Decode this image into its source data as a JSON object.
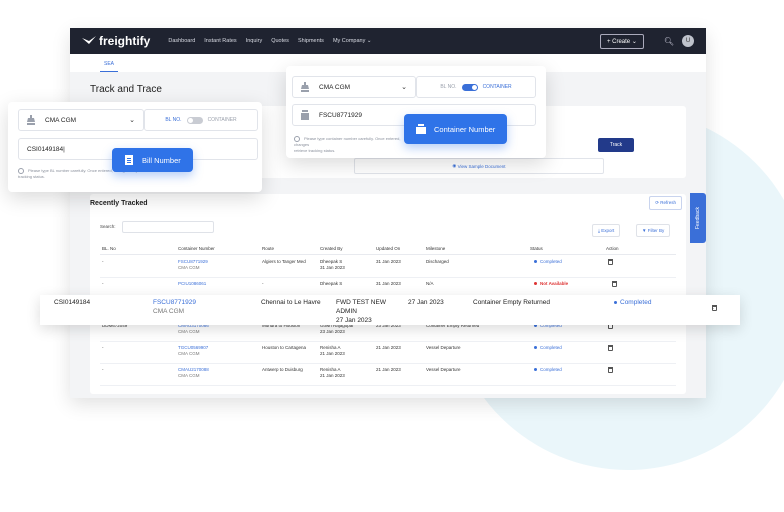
{
  "brand": {
    "name": "freightify"
  },
  "nav": {
    "items": [
      "Dashboard",
      "Instant Rates",
      "Inquiry",
      "Quotes",
      "Shipments",
      "My Company"
    ]
  },
  "header": {
    "create_label": "+ Create",
    "avatar_initial": "U"
  },
  "subtabs": {
    "active": "SEA"
  },
  "page": {
    "title": "Track and Trace"
  },
  "track_form": {
    "carrier": "CMA CGM",
    "bl_label": "BL NO.",
    "container_label": "CONTAINER",
    "container_value": "FSCU8771929",
    "bill_value": "CSI0149184",
    "hint_text": "Please type container number carefully. Once entered, changes",
    "hint_text2": "retrieve tracking status.",
    "hint_bl": "Please type BL number carefully. Once entered, changes may take time to retrieve",
    "hint_bl2": "tracking status.",
    "track_label": "Track",
    "view_sample_label": "View Sample Document"
  },
  "pills": {
    "container_number": "Container Number",
    "bill_number": "Bill Number"
  },
  "recent": {
    "title": "Recently Tracked",
    "refresh_label": "Refresh",
    "search_label": "Search:",
    "export_label": "Export",
    "filter_label": "Filter By",
    "columns": [
      "BL. No",
      "Container Number",
      "Route",
      "Created By",
      "Updated On",
      "Milestone",
      "Status",
      "Action"
    ],
    "rows": [
      {
        "bl": "-",
        "container": "FSCU8771929",
        "carrier": "CMA CGM",
        "route": "Algiers to Tanger Med",
        "created_by": "Dheepak S",
        "created_on": "31 Jan 2023",
        "updated": "31 Jan 2023",
        "milestone": "Discharged",
        "status": "Completed",
        "status_type": "ok"
      },
      {
        "bl": "-",
        "container": "PCIU1086061",
        "carrier": "",
        "route": "-",
        "created_by": "Dheepak S",
        "created_on": "",
        "updated": "31 Jan 2023",
        "milestone": "N/A",
        "status": "Not Available",
        "status_type": "na"
      },
      {
        "bl": "DDM672049",
        "container": "CMAU3170086",
        "carrier": "CMA CGM",
        "route": "Mundra to Houston",
        "created_by": "Gowri Rajagopal",
        "created_on": "23 Jan 2023",
        "updated": "23 Jan 2023",
        "milestone": "Container Empty Returned",
        "status": "Completed",
        "status_type": "ok"
      },
      {
        "bl": "-",
        "container": "TGCU0569907",
        "carrier": "CMA CGM",
        "route": "Houston to Cartagena",
        "created_by": "Renisha A",
        "created_on": "21 Jan 2023",
        "updated": "21 Jan 2023",
        "milestone": "Vessel Departure",
        "status": "Completed",
        "status_type": "ok"
      },
      {
        "bl": "-",
        "container": "CMAU2170088",
        "carrier": "CMA CGM",
        "route": "Antwerp to Duisburg",
        "created_by": "Renisha A",
        "created_on": "21 Jan 2023",
        "updated": "21 Jan 2023",
        "milestone": "Vessel Departure",
        "status": "Completed",
        "status_type": "ok"
      }
    ]
  },
  "highlight_row": {
    "bl": "CSI0149184",
    "container": "FSCU8771929",
    "carrier": "CMA CGM",
    "route": "Chennai to Le Havre",
    "created_by_line1": "FWD TEST NEW",
    "created_by_line2": "ADMIN",
    "created_on": "27 Jan 2023",
    "updated": "27 Jan 2023",
    "milestone": "Container Empty Returned",
    "status": "Completed"
  },
  "feedback_label": "Feedback",
  "colors": {
    "topbar": "#1f2330",
    "accent": "#2f73e8",
    "link": "#3a6fd8",
    "track_button": "#223a8a",
    "not_available": "#dd3333"
  }
}
